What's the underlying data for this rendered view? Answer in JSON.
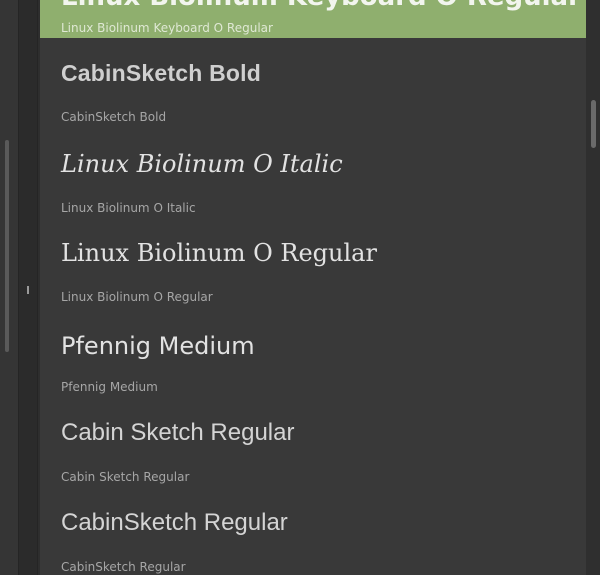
{
  "font_list": {
    "items": [
      {
        "sample": "Linux Biolinum Keyboard O Regular",
        "name": "Linux Biolinum Keyboard O Regular",
        "selected": true
      },
      {
        "sample": "CabinSketch Bold",
        "name": "CabinSketch Bold",
        "selected": false
      },
      {
        "sample": "Linux Biolinum O Italic",
        "name": "Linux Biolinum O Italic",
        "selected": false
      },
      {
        "sample": "Linux Biolinum O Regular",
        "name": "Linux Biolinum O Regular",
        "selected": false
      },
      {
        "sample": "Pfennig Medium",
        "name": "Pfennig Medium",
        "selected": false
      },
      {
        "sample": "Cabin Sketch Regular",
        "name": "Cabin Sketch Regular",
        "selected": false
      },
      {
        "sample": "CabinSketch Regular",
        "name": "CabinSketch Regular",
        "selected": false
      }
    ]
  },
  "colors": {
    "selection": "#8faf6e",
    "list_background": "#393939",
    "sample_text": "#e2e2e2",
    "caption_text": "#a6a6a6"
  }
}
